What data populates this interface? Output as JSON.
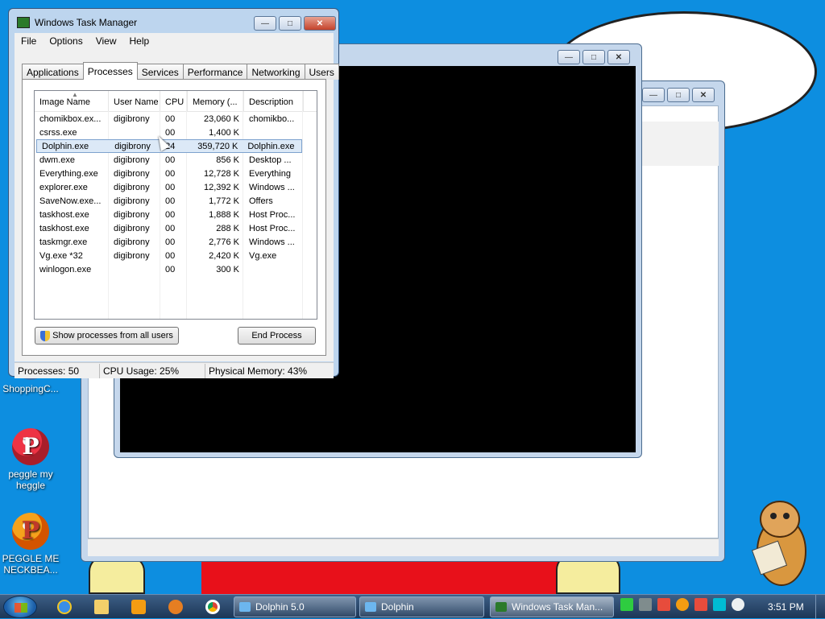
{
  "colors": {
    "desktop_bg": "#0d8ee0",
    "window_frame": "#bdd5ee",
    "selection": "#dce9f7",
    "taskbar": "#1c3656"
  },
  "desktop": {
    "icons": [
      {
        "label": "ShoppingC...",
        "icon": "shopping-icon"
      },
      {
        "label": "peggle my heggle",
        "icon": "peggle-icon"
      },
      {
        "label": "PEGGLE ME NECKBEA...",
        "icon": "peggle-icon"
      }
    ]
  },
  "task_manager": {
    "title": "Windows Task Manager",
    "menu": [
      "File",
      "Options",
      "View",
      "Help"
    ],
    "tabs": [
      "Applications",
      "Processes",
      "Services",
      "Performance",
      "Networking",
      "Users"
    ],
    "active_tab": "Processes",
    "columns": [
      "Image Name",
      "User Name",
      "CPU",
      "Memory (...",
      "Description"
    ],
    "processes": [
      {
        "name": "chomikbox.ex...",
        "user": "digibrony",
        "cpu": "00",
        "mem": "23,060 K",
        "desc": "chomikbo..."
      },
      {
        "name": "csrss.exe",
        "user": "",
        "cpu": "00",
        "mem": "1,400 K",
        "desc": ""
      },
      {
        "name": "Dolphin.exe",
        "user": "digibrony",
        "cpu": "24",
        "mem": "359,720 K",
        "desc": "Dolphin.exe"
      },
      {
        "name": "dwm.exe",
        "user": "digibrony",
        "cpu": "00",
        "mem": "856 K",
        "desc": "Desktop ..."
      },
      {
        "name": "Everything.exe",
        "user": "digibrony",
        "cpu": "00",
        "mem": "12,728 K",
        "desc": "Everything"
      },
      {
        "name": "explorer.exe",
        "user": "digibrony",
        "cpu": "00",
        "mem": "12,392 K",
        "desc": "Windows ..."
      },
      {
        "name": "SaveNow.exe...",
        "user": "digibrony",
        "cpu": "00",
        "mem": "1,772 K",
        "desc": "Offers"
      },
      {
        "name": "taskhost.exe",
        "user": "digibrony",
        "cpu": "00",
        "mem": "1,888 K",
        "desc": "Host Proc..."
      },
      {
        "name": "taskhost.exe",
        "user": "digibrony",
        "cpu": "00",
        "mem": "288 K",
        "desc": "Host Proc..."
      },
      {
        "name": "taskmgr.exe",
        "user": "digibrony",
        "cpu": "00",
        "mem": "2,776 K",
        "desc": "Windows ..."
      },
      {
        "name": "Vg.exe *32",
        "user": "digibrony",
        "cpu": "00",
        "mem": "2,420 K",
        "desc": "Vg.exe"
      },
      {
        "name": "winlogon.exe",
        "user": "",
        "cpu": "00",
        "mem": "300 K",
        "desc": ""
      }
    ],
    "selected_row": 2,
    "show_all_label": "Show processes from all users",
    "end_process_label": "End Process",
    "status": {
      "processes": "Processes: 50",
      "cpu": "CPU Usage: 25%",
      "memory": "Physical Memory: 43%"
    }
  },
  "taskbar": {
    "buttons": [
      {
        "label": "Dolphin 5.0",
        "icon": "dolphin-icon"
      },
      {
        "label": "Dolphin",
        "icon": "dolphin-icon"
      },
      {
        "label": "Windows Task Man...",
        "icon": "taskmanager-icon"
      }
    ],
    "clock": "3:51 PM"
  }
}
